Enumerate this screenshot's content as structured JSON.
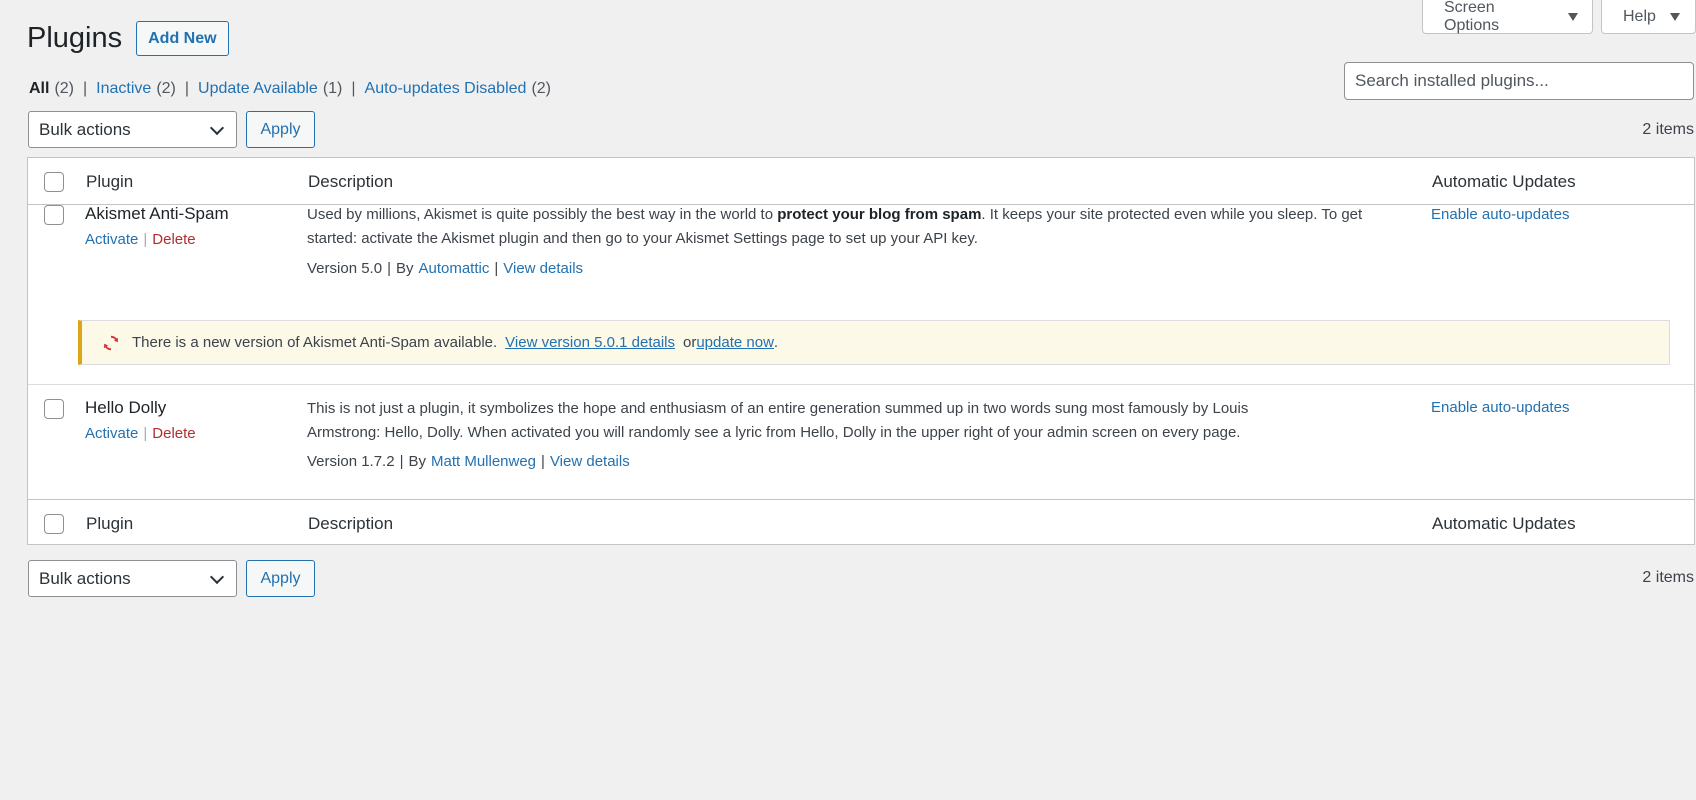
{
  "header": {
    "title": "Plugins",
    "add_new_label": "Add New",
    "screen_options_label": "Screen Options",
    "help_label": "Help"
  },
  "filters": [
    {
      "label": "All",
      "count": "(2)",
      "current": true
    },
    {
      "label": "Inactive",
      "count": "(2)"
    },
    {
      "label": "Update Available",
      "count": "(1)"
    },
    {
      "label": "Auto-updates Disabled",
      "count": "(2)"
    }
  ],
  "search": {
    "placeholder": "Search installed plugins..."
  },
  "tablenav": {
    "bulk_actions_label": "Bulk actions",
    "apply_label": "Apply",
    "items_count": "2 items"
  },
  "table": {
    "columns": {
      "plugin": "Plugin",
      "description": "Description",
      "auto_updates": "Automatic Updates"
    }
  },
  "plugins": [
    {
      "name": "Akismet Anti-Spam",
      "activate": "Activate",
      "delete": "Delete",
      "desc_part1": "Used by millions, Akismet is quite possibly the best way in the world to ",
      "desc_bold": "protect your blog from spam",
      "desc_part2": ". It keeps your site protected even while you sleep. To get started: activate the Akismet plugin and then go to your Akismet Settings page to set up your API key.",
      "version": "Version 5.0",
      "by": "By",
      "author": "Automattic",
      "view_details": "View details",
      "auto_update": "Enable auto-updates",
      "update_notice": {
        "text_before": "There is a new version of Akismet Anti-Spam available.",
        "view_link": "View version 5.0.1 details",
        "or": "or",
        "update_link": "update now",
        "end": "."
      }
    },
    {
      "name": "Hello Dolly",
      "activate": "Activate",
      "delete": "Delete",
      "desc": "This is not just a plugin, it symbolizes the hope and enthusiasm of an entire generation summed up in two words sung most famously by Louis Armstrong: Hello, Dolly. When activated you will randomly see a lyric from Hello, Dolly in the upper right of your admin screen on every page.",
      "version": "Version 1.7.2",
      "by": "By",
      "author": "Matt Mullenweg",
      "view_details": "View details",
      "auto_update": "Enable auto-updates"
    }
  ],
  "colors": {
    "link": "#2271b1",
    "delete": "#b32d2e",
    "notice_border": "#dba617",
    "notice_bg": "#fcf9e8",
    "update_icon": "#d63638"
  },
  "icons": {
    "screen_options_toggle": "caret-down-icon",
    "help_toggle": "caret-down-icon",
    "bulk_select": "chevron-down-icon",
    "update_notice": "update-icon"
  }
}
